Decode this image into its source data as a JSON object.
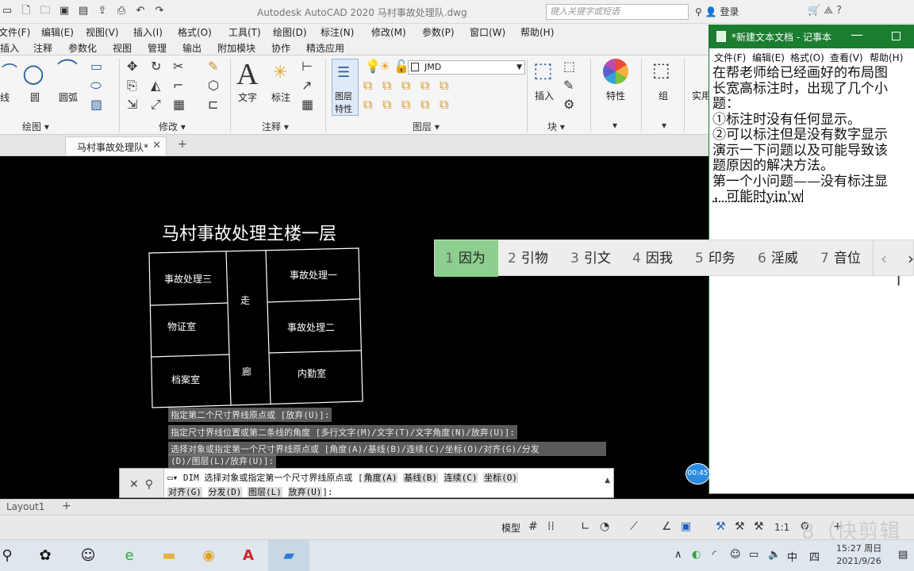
{
  "autocad": {
    "title": "Autodesk AutoCAD 2020    马村事故处理队.dwg",
    "search_placeholder": "键入关键字或短语",
    "user": "登录",
    "menu": [
      "文件(F)",
      "编辑(E)",
      "视图(V)",
      "插入(I)",
      "格式(O)",
      "工具(T)",
      "绘图(D)",
      "标注(N)",
      "修改(M)",
      "参数(P)",
      "窗口(W)",
      "帮助(H)"
    ],
    "ribbon_tabs": [
      "插入",
      "注释",
      "参数化",
      "视图",
      "管理",
      "输出",
      "附加模块",
      "协作",
      "精选应用"
    ],
    "ribbon": {
      "line": "线",
      "circle": "圆",
      "arc": "圆弧",
      "text": "文字",
      "dim": "标注",
      "layer_props": [
        "图层",
        "特性"
      ],
      "layer_name": "JMD",
      "insert": "插入",
      "properties": "特性",
      "group": "组",
      "utilities": "实用"
    },
    "ribbon_groups": {
      "draw": "绘图 ▾",
      "modify": "修改 ▾",
      "annotation": "注释 ▾",
      "layers": "图层 ▾",
      "block": "块 ▾"
    },
    "doc_tab": "马村事故处理队*",
    "layout_tab": "Layout1",
    "status_model": "模型",
    "scale": "1:1"
  },
  "drawing": {
    "title": "马村事故处理主楼一层",
    "rooms": {
      "r1": "事故处理三",
      "r2": "物证室",
      "r3": "档案室",
      "corridor1": "走",
      "corridor2": "廊",
      "r4": "事故处理一",
      "r5": "事故处理二",
      "r6": "内勤室"
    }
  },
  "command_history": [
    "指定第二个尺寸界线原点或 [放弃(U)]:",
    "指定尺寸界线位置或第二条线的角度 [多行文字(M)/文字(T)/文字角度(N)/放弃(U)]:",
    "选择对象或指定第一个尺寸界线原点或 [角度(A)/基线(B)/连续(C)/坐标(O)/对齐(G)/分发",
    "(D)/图层(L)/放弃(U)]:"
  ],
  "command_line": {
    "line1_prefix": "DIM 选择对象或指定第一个尺寸界线原点或 [",
    "options1": [
      "角度(A)",
      "基线(B)",
      "连续(C)",
      "坐标(O)"
    ],
    "options2": [
      "对齐(G)",
      "分发(D)",
      "图层(L)",
      "放弃(U)"
    ],
    "close": "]:"
  },
  "ime": {
    "candidates": [
      {
        "n": "1",
        "t": "因为"
      },
      {
        "n": "2",
        "t": "引物"
      },
      {
        "n": "3",
        "t": "引文"
      },
      {
        "n": "4",
        "t": "因我"
      },
      {
        "n": "5",
        "t": "印务"
      },
      {
        "n": "6",
        "t": "淫威"
      },
      {
        "n": "7",
        "t": "音位"
      }
    ],
    "prev": "‹",
    "next": "›"
  },
  "notepad": {
    "title": "*新建文本文档 - 记事本",
    "menu": [
      "文件(F)",
      "编辑(E)",
      "格式(O)",
      "查看(V)",
      "帮助(H)"
    ],
    "lines": [
      "在帮老师给已经画好的布局图",
      "长宽高标注时，出现了几个小",
      "题：",
      "①标注时没有任何显示。",
      "②可以标注但是没有数字显示",
      "",
      "演示一下问题以及可能导致该",
      "题原因的解决方法。",
      "",
      "第一个小问题——没有标注显"
    ],
    "last_line": "，可能时yin'w"
  },
  "recorder": "00:45",
  "watermark": "8（快剪辑",
  "tray": {
    "ime": "中",
    "ime2": "四",
    "time": "15:27 周日",
    "date": "2021/9/26"
  }
}
